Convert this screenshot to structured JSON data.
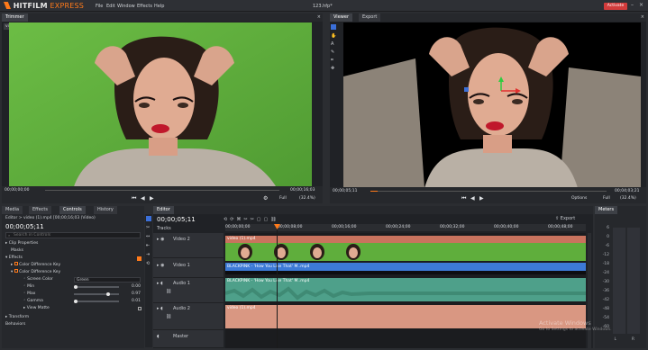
{
  "app": {
    "logo_main": "HITFILM",
    "logo_sub": "EXPRESS",
    "menu": [
      "File",
      "Edit",
      "Window",
      "Effects",
      "Help"
    ],
    "doc_title": "123.hfp*",
    "activate_label": "Activate"
  },
  "trimmer": {
    "tab": "Trimmer",
    "clip_label": "video (1).mp4",
    "time_start": "00;00;00;00",
    "time_end": "00;00;16;03",
    "zoom_label": "Full",
    "zoom_pct": "(32.4%)"
  },
  "viewer": {
    "tabs": [
      "Viewer",
      "Export"
    ],
    "time_current": "00;00;05;11",
    "time_end": "00;04;03;21",
    "zoom_label": "Full",
    "zoom_pct": "(32.4%)",
    "options_label": "Options"
  },
  "left_panel": {
    "tabs": [
      "Media",
      "Effects",
      "Controls",
      "History"
    ],
    "breadcrumb": "Editor > video (1).mp4 [00;00;16;03 (Video)",
    "timecode": "00;00;05;11",
    "search_placeholder": "Search in Controls",
    "sections": {
      "clip_properties": "Clip Properties",
      "masks": "Masks",
      "effects": "Effects",
      "color_diff_1": "Color Difference Key",
      "color_diff_2": "Color Difference Key",
      "screen_color": "Screen Color",
      "screen_color_value": "Green",
      "min": "Min",
      "min_value": "0.00",
      "max": "Max",
      "max_value": "0.97",
      "gamma": "Gamma",
      "gamma_value": "0.01",
      "view_matte": "View Matte",
      "transform": "Transform",
      "behaviors": "Behaviors"
    }
  },
  "editor": {
    "tab": "Editor",
    "timecode": "00;00;05;11",
    "export_label": "Export",
    "tracks_label": "Tracks",
    "track_names": [
      "Video 2",
      "Video 1",
      "Audio 1",
      "Audio 2"
    ],
    "master_label": "Master",
    "ruler_ticks": [
      "00;00;00;00",
      "00;00;08;00",
      "00;00;16;00",
      "00;00;24;00",
      "00;00;32;00",
      "00;00;40;00",
      "00;00;48;00"
    ],
    "clips": {
      "video2": "video (1).mp4",
      "video1": "BLACKPINK - 'How You Like That' M..mp4",
      "audio1": "BLACKPINK - 'How You Like That' M..mp4",
      "audio2": "video (1).mp4"
    }
  },
  "meters": {
    "tab": "Meters",
    "labels": [
      "6",
      "0",
      "-6",
      "-12",
      "-18",
      "-24",
      "-30",
      "-36",
      "-42",
      "-48",
      "-54",
      "-60"
    ],
    "lr": [
      "L",
      "R"
    ]
  },
  "watermark": {
    "line1": "Activate Windows",
    "line2": "Go to Settings to activate Windows."
  },
  "colors": {
    "accent": "#ff7a1a",
    "green_screen": "#5fae3c",
    "video_clip": "#c9735e",
    "blue_clip": "#3d7ad6",
    "audio_clip": "#4ea08a",
    "audio2_clip": "#d99782"
  }
}
